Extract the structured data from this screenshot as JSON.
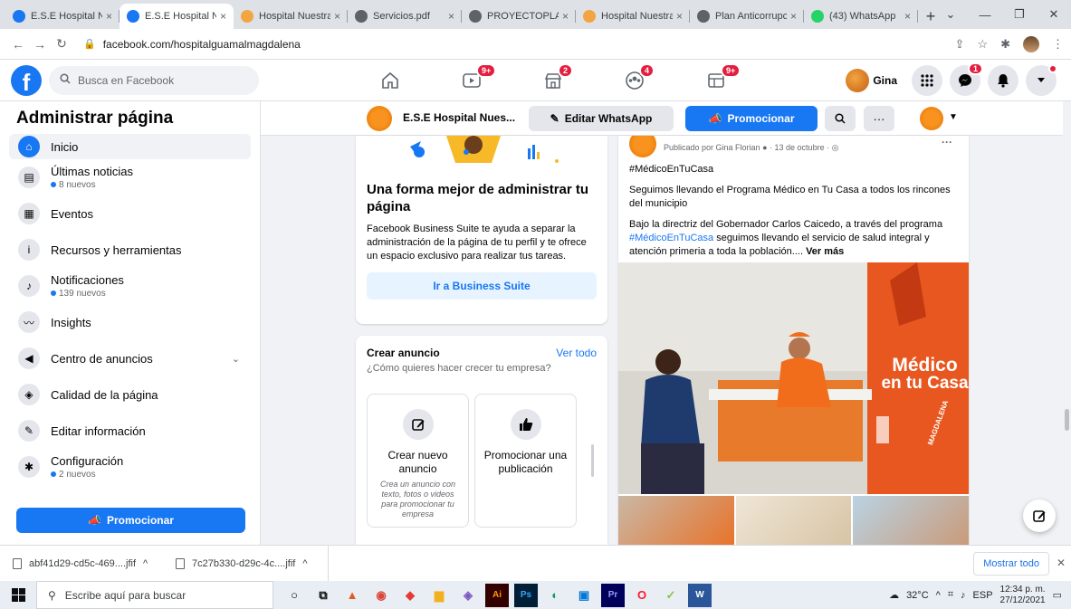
{
  "browser": {
    "tabs": [
      {
        "title": "E.S.E Hospital Nu",
        "icon": "facebook-icon",
        "color": "#1877f2"
      },
      {
        "title": "E.S.E Hospital Nu",
        "icon": "facebook-icon",
        "color": "#1877f2",
        "active": true
      },
      {
        "title": "Hospital Nuestra",
        "icon": "site-icon",
        "color": "#f2a541"
      },
      {
        "title": "Servicios.pdf",
        "icon": "globe-icon",
        "color": "#5f6368"
      },
      {
        "title": "PROYECTOPLANE",
        "icon": "globe-icon",
        "color": "#5f6368"
      },
      {
        "title": "Hospital Nuestra",
        "icon": "site-icon",
        "color": "#f2a541"
      },
      {
        "title": "Plan Anticorrupci",
        "icon": "globe-icon",
        "color": "#5f6368"
      },
      {
        "title": "(43) WhatsApp",
        "icon": "whatsapp-icon",
        "color": "#25d366"
      }
    ],
    "new_tab": "+",
    "url": "facebook.com/hospitalguamalmagdalena"
  },
  "fb_nav": {
    "search_placeholder": "Busca en Facebook",
    "badges": {
      "watch": "9+",
      "marketplace": "2",
      "groups": "4",
      "gaming": "9+"
    },
    "user_name": "Gina",
    "messenger_badge": "1"
  },
  "sidebar": {
    "title": "Administrar página",
    "items": [
      {
        "label": "Inicio",
        "sub": "",
        "icon": "home-icon"
      },
      {
        "label": "Últimas noticias",
        "sub": "8 nuevos",
        "icon": "news-icon"
      },
      {
        "label": "Eventos",
        "sub": "",
        "icon": "calendar-icon"
      },
      {
        "label": "Recursos y herramientas",
        "sub": "",
        "icon": "info-icon"
      },
      {
        "label": "Notificaciones",
        "sub": "139 nuevos",
        "icon": "bell-icon"
      },
      {
        "label": "Insights",
        "sub": "",
        "icon": "chart-icon"
      },
      {
        "label": "Centro de anuncios",
        "sub": "",
        "icon": "megaphone-icon"
      },
      {
        "label": "Calidad de la página",
        "sub": "",
        "icon": "shield-icon"
      },
      {
        "label": "Editar información",
        "sub": "",
        "icon": "pencil-icon"
      },
      {
        "label": "Configuración",
        "sub": "2 nuevos",
        "icon": "gear-icon"
      }
    ],
    "promote": "Promocionar"
  },
  "page_bar": {
    "name": "E.S.E Hospital Nues...",
    "edit_whatsapp": "Editar WhatsApp",
    "promote": "Promocionar"
  },
  "business_suite": {
    "title": "Una forma mejor de administrar tu página",
    "text": "Facebook Business Suite te ayuda a separar la administración de la página de tu perfil y te ofrece un espacio exclusivo para realizar tus tareas.",
    "button": "Ir a Business Suite"
  },
  "create_ad": {
    "title": "Crear anuncio",
    "see_all": "Ver todo",
    "subtitle": "¿Cómo quieres hacer crecer tu empresa?",
    "tiles": [
      {
        "label": "Crear nuevo anuncio",
        "desc": "Crea un anuncio con texto, fotos o videos para promocionar tu empresa"
      },
      {
        "label": "Promocionar una publicación",
        "desc": ""
      }
    ]
  },
  "post": {
    "meta": "Publicado por Gina Florian",
    "date": "· 13 de octubre ·",
    "hashtag": "#MédicoEnTuCasa",
    "p1": "Seguimos llevando el Programa Médico en Tu Casa a todos los rincones del municipio",
    "p2_a": "Bajo la directriz del Gobernador Carlos Caicedo, a través del programa ",
    "p2_link": "#MédicoEnTuCasa",
    "p2_b": " seguimos llevando el servicio de salud integral y atención primeria a toda la población.... ",
    "see_more": "Ver más",
    "poster_line1": "Médico",
    "poster_line2": "en tu Casa",
    "poster_small": "MAGDALENA"
  },
  "downloads": {
    "items": [
      "abf41d29-cd5c-469....jfif",
      "7c27b330-d29c-4c....jfif"
    ],
    "show_all": "Mostrar todo"
  },
  "taskbar": {
    "search_placeholder": "Escribe aquí para buscar",
    "temp": "32°C",
    "lang": "ESP",
    "time": "12:34 p. m.",
    "date": "27/12/2021"
  }
}
